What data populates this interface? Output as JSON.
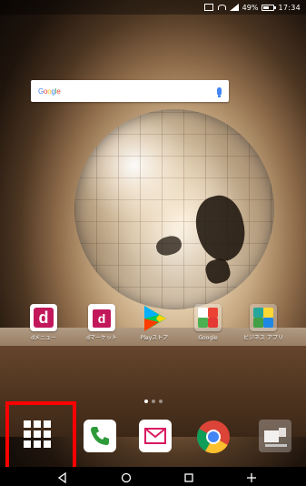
{
  "statusbar": {
    "battery_percent": "49%",
    "battery_level": 0.49,
    "time": "17:34"
  },
  "search": {
    "logo_text": "Google",
    "mic_icon": "microphone-icon"
  },
  "apps": [
    {
      "label": "dメニュー",
      "icon": "d-menu-icon"
    },
    {
      "label": "dマーケット",
      "icon": "d-market-icon"
    },
    {
      "label": "Playストア",
      "icon": "play-store-icon"
    },
    {
      "label": "Google",
      "icon": "google-folder-icon"
    },
    {
      "label": "ビジネス アプリ",
      "icon": "business-folder-icon"
    }
  ],
  "page_indicator": {
    "pages": 3,
    "active": 0
  },
  "dock": {
    "items": [
      {
        "name": "app-drawer",
        "icon": "app-drawer-icon"
      },
      {
        "name": "phone",
        "icon": "phone-icon"
      },
      {
        "name": "messages",
        "icon": "mail-icon"
      },
      {
        "name": "chrome",
        "icon": "chrome-icon"
      },
      {
        "name": "camera-folder",
        "icon": "camera-folder-icon"
      }
    ]
  },
  "navbar": {
    "buttons": [
      {
        "name": "back",
        "glyph": "◁"
      },
      {
        "name": "home",
        "glyph": "○"
      },
      {
        "name": "recents",
        "glyph": "□"
      },
      {
        "name": "extra",
        "glyph": "+"
      }
    ]
  },
  "colors": {
    "highlight": "#ff0000",
    "docomo_magenta": "#c2185b"
  }
}
